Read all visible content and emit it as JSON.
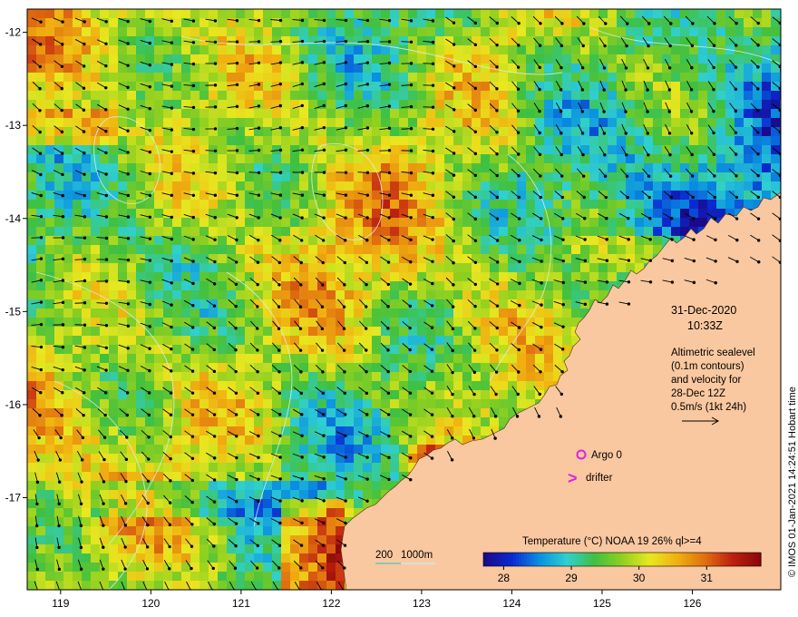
{
  "map": {
    "lon_min": 118.63,
    "lon_max": 126.98,
    "lat_min": -17.99,
    "lat_max": -11.75,
    "x_ticks": [
      {
        "value": 119,
        "label": "119"
      },
      {
        "value": 120,
        "label": "120"
      },
      {
        "value": 121,
        "label": "121"
      },
      {
        "value": 122,
        "label": "122"
      },
      {
        "value": 123,
        "label": "123"
      },
      {
        "value": 124,
        "label": "124"
      },
      {
        "value": 125,
        "label": "125"
      },
      {
        "value": 126,
        "label": "126"
      }
    ],
    "y_ticks": [
      {
        "value": -12,
        "label": "-12"
      },
      {
        "value": -13,
        "label": "-13"
      },
      {
        "value": -14,
        "label": "-14"
      },
      {
        "value": -15,
        "label": "-15"
      },
      {
        "value": -16,
        "label": "-16"
      },
      {
        "value": -17,
        "label": "-17"
      }
    ]
  },
  "info": {
    "date": "31-Dec-2020",
    "time": "10:33Z",
    "desc_line1": "Altimetric sealevel",
    "desc_line2": "(0.1m contours)",
    "desc_line3": "and velocity for",
    "desc_line4": "28-Dec 12Z",
    "scale_label": "0.5m/s (1kt 24h)"
  },
  "legend": {
    "argo_label": "Argo 0",
    "drifter_label": "drifter",
    "drifter_symbol": ">",
    "argo_color": "#e020e0",
    "drifter_color": "#e020e0"
  },
  "depth_legend": {
    "label_200": "200",
    "label_1000": "1000m",
    "color_200": "#40c8c8",
    "color_1000": "#c0f0f0"
  },
  "colorbar": {
    "title": "Temperature (°C) NOAA 19 26% ql>=4",
    "min": 27.7,
    "max": 31.8,
    "ticks": [
      {
        "value": 28,
        "label": "28"
      },
      {
        "value": 29,
        "label": "29"
      },
      {
        "value": 30,
        "label": "30"
      },
      {
        "value": 31,
        "label": "31"
      }
    ],
    "colors": [
      "#1a0a8a",
      "#0a2ad0",
      "#0a90e0",
      "#30d0d0",
      "#40c040",
      "#90d020",
      "#e8e820",
      "#f0b010",
      "#e07010",
      "#c02010",
      "#8a0a0a"
    ]
  },
  "land_color": "#fac8a0",
  "stamp": "© IMOS 01-Jan-2021 14:24:51 Hobart time"
}
